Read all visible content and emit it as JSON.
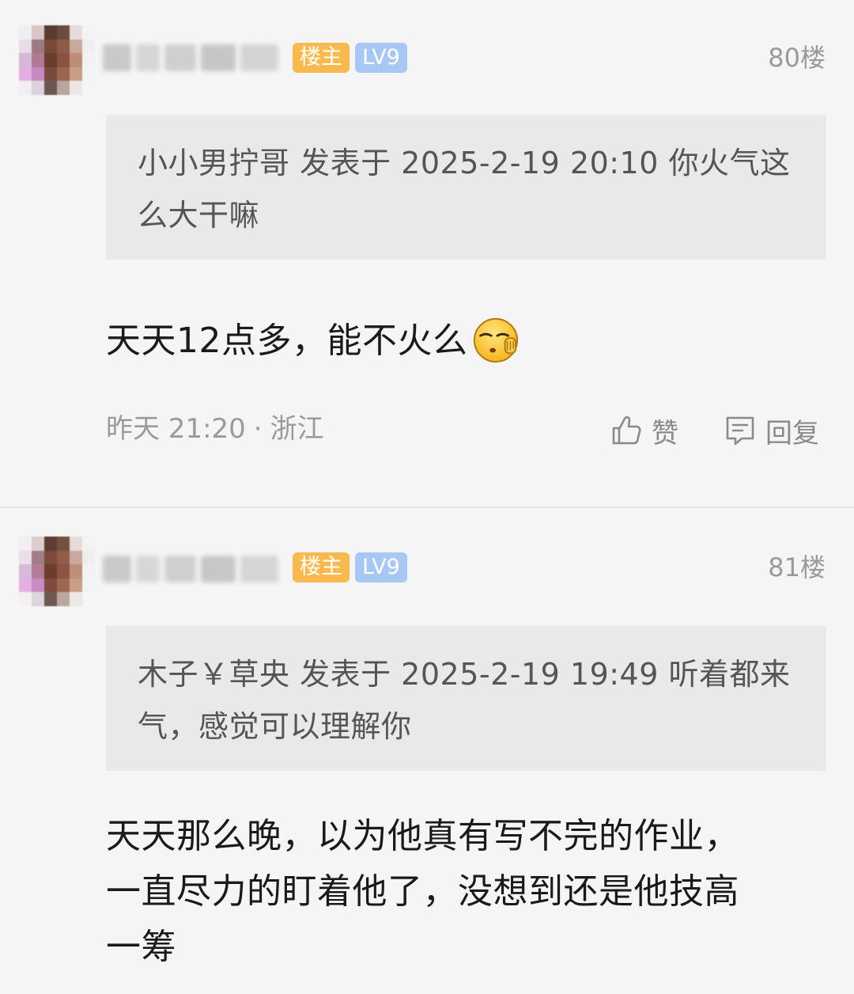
{
  "posts": [
    {
      "badges": {
        "host": "楼主",
        "level": "LV9"
      },
      "floor": "80楼",
      "quote": "小小男拧哥 发表于 2025-2-19 20:10 你火气这么大干嘛",
      "body": "天天12点多，能不火么",
      "emoji": "squinting-hand-over-mouth-emoji",
      "meta": {
        "time": "昨天 21:20",
        "separator": "·",
        "location": "浙江"
      },
      "actions": {
        "like": "赞",
        "reply": "回复"
      }
    },
    {
      "badges": {
        "host": "楼主",
        "level": "LV9"
      },
      "floor": "81楼",
      "quote": "木子￥草央 发表于 2025-2-19 19:49 听着都来气，感觉可以理解你",
      "body_lines": [
        "天天那么晚，以为他真有写不完的作业，",
        "一直尽力的盯着他了，没想到还是他技高",
        "一筹"
      ]
    }
  ],
  "colors": {
    "host_badge": "#f8b94e",
    "level_badge": "#a9c7f5",
    "quote_bg": "#e9e9e9",
    "page_bg": "#f5f5f5"
  }
}
